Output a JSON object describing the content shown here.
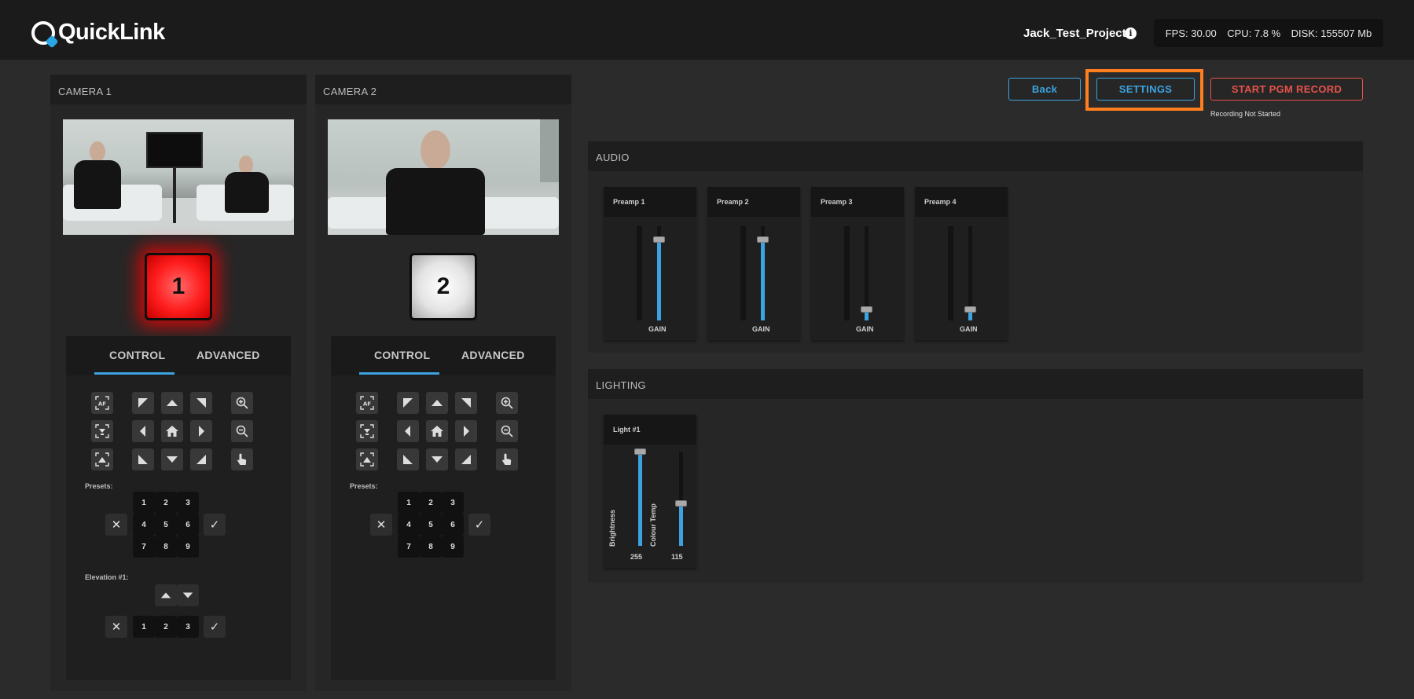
{
  "header": {
    "logo_text": "QuickLink",
    "project_name": "Jack_Test_Project",
    "info_icon": "i",
    "stats": {
      "fps": "FPS: 30.00",
      "cpu": "CPU: 7.8 %",
      "disk": "DISK: 155507 Mb"
    }
  },
  "cameras": [
    {
      "title": "CAMERA 1",
      "tally_number": "1",
      "tally_state": "live",
      "tabs": {
        "control": "CONTROL",
        "advanced": "ADVANCED",
        "active": "control"
      },
      "ptz": {
        "af_label": "AF"
      },
      "presets_label": "Presets:",
      "presets": [
        "1",
        "2",
        "3",
        "4",
        "5",
        "6",
        "7",
        "8",
        "9"
      ],
      "preset_cancel": "✕",
      "preset_confirm": "✓",
      "elevation_label": "Elevation #1:",
      "elevation_presets": [
        "1",
        "2",
        "3"
      ],
      "elevation_cancel": "✕",
      "elevation_confirm": "✓"
    },
    {
      "title": "CAMERA 2",
      "tally_number": "2",
      "tally_state": "idle",
      "tabs": {
        "control": "CONTROL",
        "advanced": "ADVANCED",
        "active": "control"
      },
      "ptz": {
        "af_label": "AF"
      },
      "presets_label": "Presets:",
      "presets": [
        "1",
        "2",
        "3",
        "4",
        "5",
        "6",
        "7",
        "8",
        "9"
      ],
      "preset_cancel": "✕",
      "preset_confirm": "✓"
    }
  ],
  "actions": {
    "back": "Back",
    "settings": "SETTINGS",
    "record": "START PGM RECORD",
    "record_status": "Recording Not Started"
  },
  "audio": {
    "title": "AUDIO",
    "channels": [
      {
        "name": "Preamp 1",
        "label": "GAIN",
        "level": 0.86
      },
      {
        "name": "Preamp 2",
        "label": "GAIN",
        "level": 0.86
      },
      {
        "name": "Preamp 3",
        "label": "GAIN",
        "level": 0.12
      },
      {
        "name": "Preamp 4",
        "label": "GAIN",
        "level": 0.12
      }
    ]
  },
  "lighting": {
    "title": "LIGHTING",
    "lights": [
      {
        "name": "Light #1",
        "controls": [
          {
            "label": "Brightness",
            "value": "255",
            "level": 1.0
          },
          {
            "label": "Colour Temp",
            "value": "115",
            "level": 0.45
          }
        ]
      }
    ]
  },
  "colors": {
    "accent": "#3da3e0",
    "record": "#e5534b",
    "highlight": "#ff7e1f",
    "tally_live": "#ff1c1c"
  }
}
